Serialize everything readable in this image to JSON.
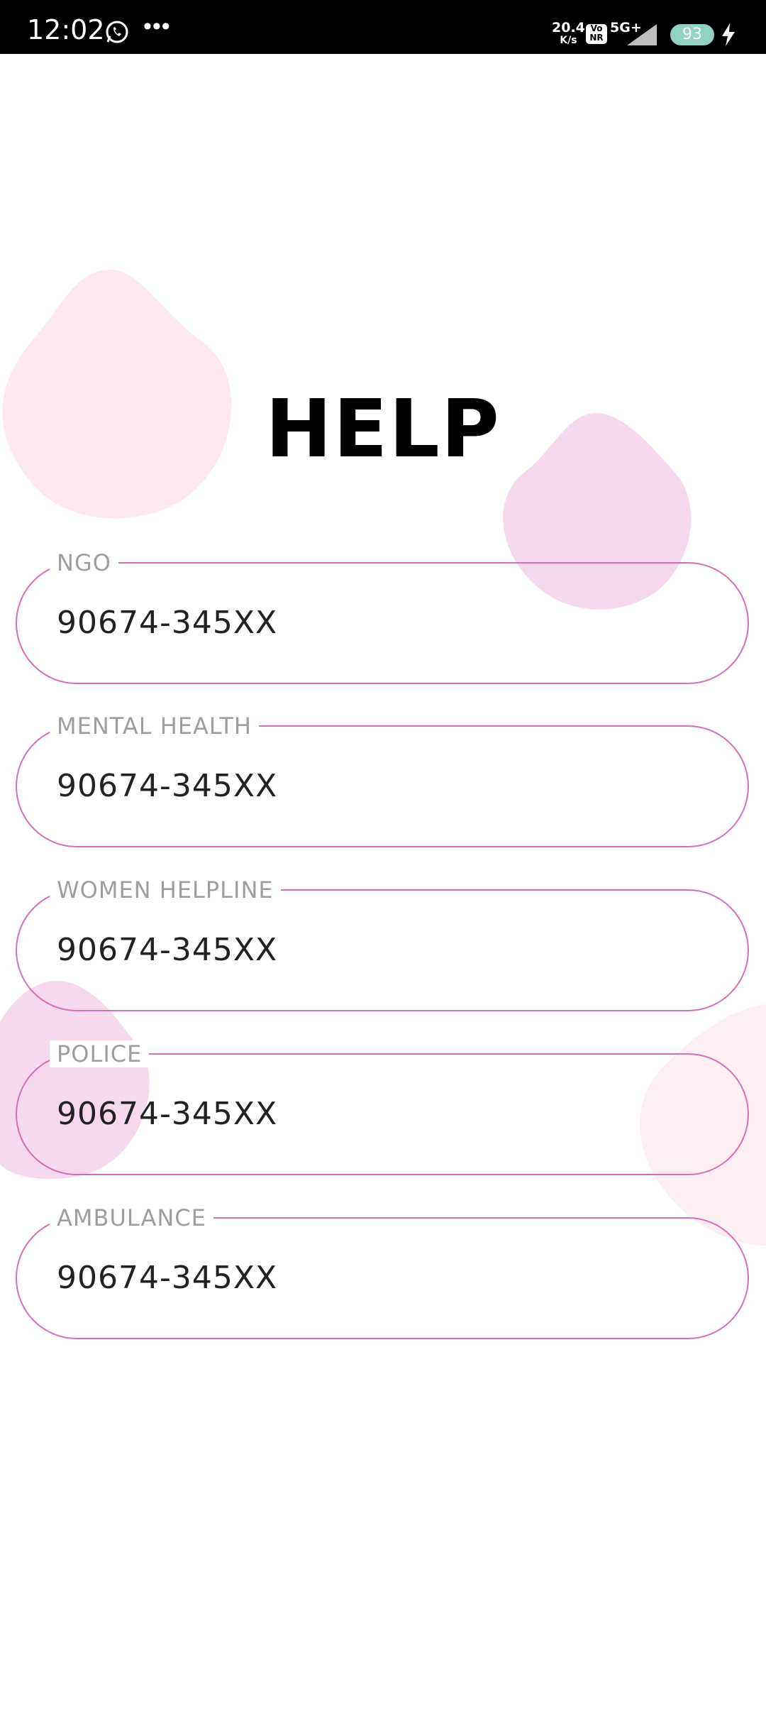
{
  "status_bar": {
    "time": "12:02",
    "speed_value": "20.4",
    "speed_unit": "K/s",
    "volte_line1": "Vo",
    "volte_line2": "NR",
    "network": "5G+",
    "battery": "93",
    "icons": [
      "whatsapp-icon",
      "more-icon",
      "signal-icon",
      "charging-icon"
    ]
  },
  "page": {
    "title": "HELP",
    "accent_color": "#d670b6",
    "blob_color": "#f6d9ec"
  },
  "contacts": [
    {
      "label": "NGO",
      "number": "90674-345XX"
    },
    {
      "label": "MENTAL HEALTH",
      "number": "90674-345XX"
    },
    {
      "label": "WOMEN HELPLINE",
      "number": "90674-345XX"
    },
    {
      "label": "POLICE",
      "number": "90674-345XX"
    },
    {
      "label": "AMBULANCE",
      "number": "90674-345XX"
    }
  ]
}
